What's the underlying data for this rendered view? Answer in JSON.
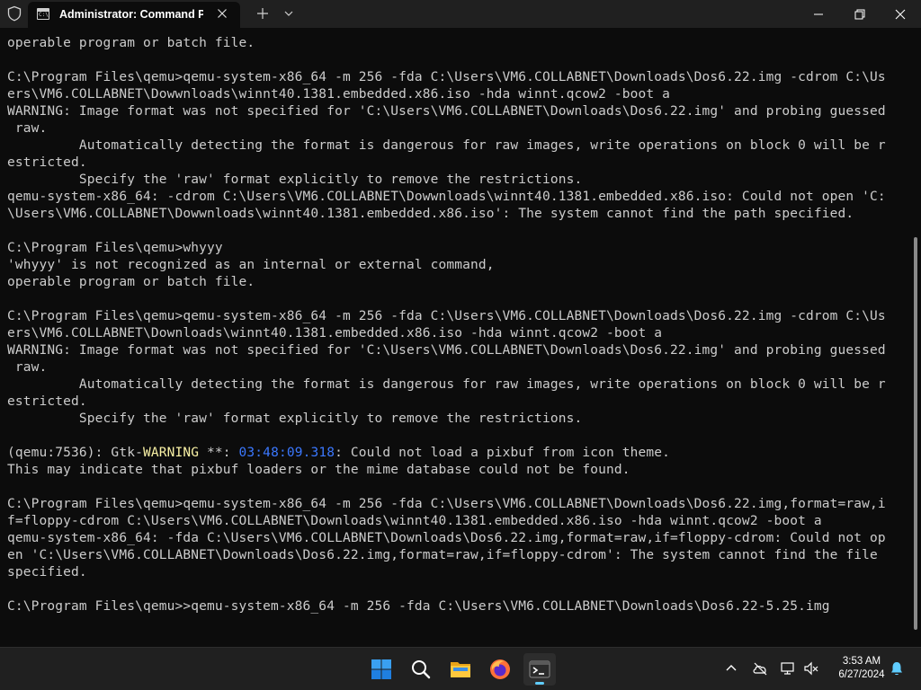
{
  "window": {
    "tab_title": "Administrator: Command Pro",
    "tab_icon_text": "C:\\"
  },
  "terminal": {
    "lines": [
      [
        {
          "t": "operable program or batch file."
        }
      ],
      [
        {
          "t": ""
        }
      ],
      [
        {
          "t": "C:\\Program Files\\qemu>qemu-system-x86_64 -m 256 -fda C:\\Users\\VM6.COLLABNET\\Downloads\\Dos6.22.img -cdrom C:\\Us"
        }
      ],
      [
        {
          "t": "ers\\VM6.COLLABNET\\Dowwnloads\\winnt40.1381.embedded.x86.iso -hda winnt.qcow2 -boot a"
        }
      ],
      [
        {
          "t": "WARNING: Image format was not specified for 'C:\\Users\\VM6.COLLABNET\\Downloads\\Dos6.22.img' and probing guessed"
        }
      ],
      [
        {
          "t": " raw."
        }
      ],
      [
        {
          "t": "         Automatically detecting the format is dangerous for raw images, write operations on block 0 will be r"
        }
      ],
      [
        {
          "t": "estricted."
        }
      ],
      [
        {
          "t": "         Specify the 'raw' format explicitly to remove the restrictions."
        }
      ],
      [
        {
          "t": "qemu-system-x86_64: -cdrom C:\\Users\\VM6.COLLABNET\\Dowwnloads\\winnt40.1381.embedded.x86.iso: Could not open 'C:"
        }
      ],
      [
        {
          "t": "\\Users\\VM6.COLLABNET\\Dowwnloads\\winnt40.1381.embedded.x86.iso': The system cannot find the path specified."
        }
      ],
      [
        {
          "t": ""
        }
      ],
      [
        {
          "t": "C:\\Program Files\\qemu>whyyy"
        }
      ],
      [
        {
          "t": "'whyyy' is not recognized as an internal or external command,"
        }
      ],
      [
        {
          "t": "operable program or batch file."
        }
      ],
      [
        {
          "t": ""
        }
      ],
      [
        {
          "t": "C:\\Program Files\\qemu>qemu-system-x86_64 -m 256 -fda C:\\Users\\VM6.COLLABNET\\Downloads\\Dos6.22.img -cdrom C:\\Us"
        }
      ],
      [
        {
          "t": "ers\\VM6.COLLABNET\\Downloads\\winnt40.1381.embedded.x86.iso -hda winnt.qcow2 -boot a"
        }
      ],
      [
        {
          "t": "WARNING: Image format was not specified for 'C:\\Users\\VM6.COLLABNET\\Downloads\\Dos6.22.img' and probing guessed"
        }
      ],
      [
        {
          "t": " raw."
        }
      ],
      [
        {
          "t": "         Automatically detecting the format is dangerous for raw images, write operations on block 0 will be r"
        }
      ],
      [
        {
          "t": "estricted."
        }
      ],
      [
        {
          "t": "         Specify the 'raw' format explicitly to remove the restrictions."
        }
      ],
      [
        {
          "t": ""
        }
      ],
      [
        {
          "t": "(qemu:7536): Gtk-"
        },
        {
          "t": "WARNING",
          "c": "warn"
        },
        {
          "t": " **: "
        },
        {
          "t": "03:48:09.318",
          "c": "time"
        },
        {
          "t": ": Could not load a pixbuf from icon theme."
        }
      ],
      [
        {
          "t": "This may indicate that pixbuf loaders or the mime database could not be found."
        }
      ],
      [
        {
          "t": ""
        }
      ],
      [
        {
          "t": "C:\\Program Files\\qemu>qemu-system-x86_64 -m 256 -fda C:\\Users\\VM6.COLLABNET\\Downloads\\Dos6.22.img,format=raw,i"
        }
      ],
      [
        {
          "t": "f=floppy-cdrom C:\\Users\\VM6.COLLABNET\\Downloads\\winnt40.1381.embedded.x86.iso -hda winnt.qcow2 -boot a"
        }
      ],
      [
        {
          "t": "qemu-system-x86_64: -fda C:\\Users\\VM6.COLLABNET\\Downloads\\Dos6.22.img,format=raw,if=floppy-cdrom: Could not op"
        }
      ],
      [
        {
          "t": "en 'C:\\Users\\VM6.COLLABNET\\Downloads\\Dos6.22.img,format=raw,if=floppy-cdrom': The system cannot find the file"
        }
      ],
      [
        {
          "t": "specified."
        }
      ],
      [
        {
          "t": ""
        }
      ],
      [
        {
          "t": "C:\\Program Files\\qemu>>qemu-system-x86_64 -m 256 -fda C:\\Users\\VM6.COLLABNET\\Downloads\\Dos6.22-5.25.img"
        }
      ]
    ]
  },
  "taskbar": {
    "apps": [
      {
        "name": "start-button",
        "icon": "windows-logo-icon"
      },
      {
        "name": "search-button",
        "icon": "search-icon"
      },
      {
        "name": "file-explorer-button",
        "icon": "folder-icon"
      },
      {
        "name": "firefox-button",
        "icon": "firefox-icon"
      },
      {
        "name": "terminal-button",
        "icon": "terminal-icon",
        "active": true
      }
    ],
    "time": "3:53 AM",
    "date": "6/27/2024"
  },
  "colors": {
    "terminal_bg": "#0c0c0c",
    "terminal_fg": "#cccccc",
    "warning_yellow": "#f9f1a5",
    "timestamp_blue": "#3b78ff",
    "titlebar_bg": "#202020",
    "accent": "#60cdff"
  }
}
